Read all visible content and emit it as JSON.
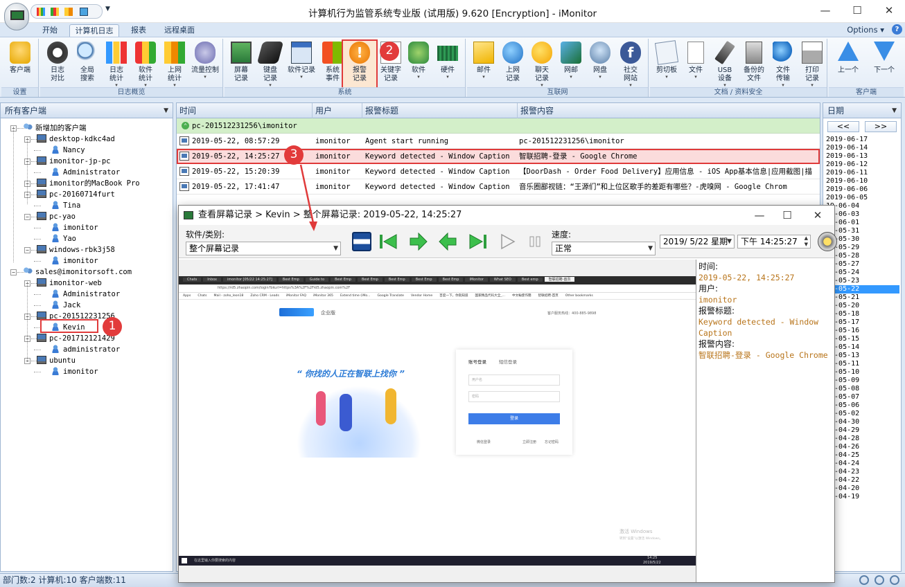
{
  "window": {
    "title": "计算机行为监管系统专业版 (试用版) 9.620 [Encryption] - iMonitor"
  },
  "menu_tabs": [
    "开始",
    "计算机日志",
    "报表",
    "远程桌面"
  ],
  "options_label": "Options",
  "ribbon": {
    "groups": {
      "settings": "设置",
      "log_overview": "日志概览",
      "system": "系统",
      "internet": "互联网",
      "docs_security": "文档 / 资料安全",
      "client": "客户端"
    },
    "buttons": {
      "client": "客户端",
      "daily_compare": "日志对比",
      "global_search": "全局搜索",
      "log_stats": "日志统计",
      "software_stats": "软件统计",
      "web_stats": "上网统计",
      "traffic_control": "流量控制",
      "screen_record": "屏幕记录",
      "keyboard_record": "键盘记录",
      "software_record": "软件记录",
      "system_event": "系统事件",
      "alarm_record": "报警记录",
      "keyword_record": "关键字记录",
      "software": "软件",
      "hardware": "硬件",
      "email": "邮件",
      "web_record": "上网记录",
      "chat_record": "聊天记录",
      "network": "网邮",
      "netdisk": "网盘",
      "social_site": "社交网站",
      "clipboard": "剪切板",
      "file": "文件",
      "usb_device": "USB设备",
      "backup_file": "备份的文件",
      "file_transfer": "文件传输",
      "print_record": "打印记录",
      "prev": "上一个",
      "next": "下一个"
    }
  },
  "left_panel": {
    "header": "所有客户端",
    "tree": [
      {
        "label": "新增加的客户端",
        "kind": "group"
      },
      {
        "label": "desktop-kdkc4ad",
        "kind": "pc"
      },
      {
        "label": "Nancy",
        "kind": "user"
      },
      {
        "label": "imonitor-jp-pc",
        "kind": "pc"
      },
      {
        "label": "Administrator",
        "kind": "user"
      },
      {
        "label": "imonitor的MacBook Pro",
        "kind": "pc"
      },
      {
        "label": "pc-20160714furt",
        "kind": "pc"
      },
      {
        "label": "Tina",
        "kind": "user"
      },
      {
        "label": "pc-yao",
        "kind": "pc"
      },
      {
        "label": "imonitor",
        "kind": "user"
      },
      {
        "label": "Yao",
        "kind": "user"
      },
      {
        "label": "windows-rbk3j58",
        "kind": "pc"
      },
      {
        "label": "imonitor",
        "kind": "user"
      },
      {
        "label": "sales@imonitorsoft.com",
        "kind": "group"
      },
      {
        "label": "imonitor-web",
        "kind": "pc"
      },
      {
        "label": "Administrator",
        "kind": "user"
      },
      {
        "label": "Jack",
        "kind": "user"
      },
      {
        "label": "pc-201512231256",
        "kind": "pc"
      },
      {
        "label": "Kevin",
        "kind": "user"
      },
      {
        "label": "pc-201712121429",
        "kind": "pc"
      },
      {
        "label": "administrator",
        "kind": "user"
      },
      {
        "label": "ubuntu",
        "kind": "pc"
      },
      {
        "label": "imonitor",
        "kind": "user"
      }
    ]
  },
  "table": {
    "columns": [
      "时间",
      "用户",
      "报警标题",
      "报警内容"
    ],
    "group_label": "pc-201512231256\\imonitor",
    "rows": [
      {
        "time": "2019-05-22, 08:57:29",
        "user": "imonitor",
        "title": "Agent start running",
        "content": "pc-201512231256\\imonitor"
      },
      {
        "time": "2019-05-22, 14:25:27",
        "user": "imonitor",
        "title": "Keyword detected - Window Caption",
        "content": "智联招聘-登录 - Google Chrome"
      },
      {
        "time": "2019-05-22, 15:20:39",
        "user": "imonitor",
        "title": "Keyword detected - Window Caption",
        "content": "【DoorDash - Order Food Delivery】应用信息 - iOS App基本信息|应用截图|描"
      },
      {
        "time": "2019-05-22, 17:41:47",
        "user": "imonitor",
        "title": "Keyword detected - Window Caption",
        "content": "音乐圈鄙视链：“王源们”和上位区歌手的差距有哪些？-虎嗅网 - Google Chrom"
      }
    ]
  },
  "right_panel": {
    "header": "日期",
    "prev_btn": "<<",
    "next_btn": ">>",
    "dates": [
      "2019-06-17",
      "2019-06-14",
      "2019-06-13",
      "2019-06-12",
      "2019-06-11",
      "2019-06-10",
      "2019-06-06",
      "2019-06-05",
      "19-06-04",
      "19-06-03",
      "19-06-01",
      "19-05-31",
      "19-05-30",
      "19-05-29",
      "19-05-28",
      "19-05-27",
      "19-05-24",
      "19-05-23",
      "19-05-22",
      "19-05-21",
      "19-05-20",
      "19-05-18",
      "19-05-17",
      "19-05-16",
      "19-05-15",
      "19-05-14",
      "19-05-13",
      "19-05-11",
      "19-05-10",
      "19-05-09",
      "19-05-08",
      "19-05-07",
      "19-05-06",
      "19-05-02",
      "19-04-30",
      "19-04-29",
      "19-04-28",
      "19-04-26",
      "19-04-25",
      "19-04-24",
      "19-04-23",
      "19-04-22",
      "19-04-20",
      "19-04-19"
    ],
    "selected_index": 18
  },
  "status": {
    "text": "部门数:2 计算机:10 客户端数:11"
  },
  "dialog": {
    "title": "查看屏幕记录 > Kevin > 整个屏幕记录: 2019-05-22, 14:25:27",
    "category_label": "软件/类别:",
    "category_value": "整个屏幕记录",
    "speed_label": "速度:",
    "speed_value": "正常",
    "date_value": "2019/ 5/22 星期",
    "time_value": "下午 14:25:27",
    "info": {
      "time_label": "时间:",
      "time_value": "2019-05-22, 14:25:27",
      "user_label": "用户:",
      "user_value": "imonitor",
      "title_label": "报警标题:",
      "title_value": "Keyword detected - Window Caption",
      "content_label": "报警内容:",
      "content_value": "智联招聘-登录 - Google Chrome"
    },
    "snapshot": {
      "tabs": [
        "Chats",
        "Inbox",
        "imonitor [05/22 14:25:27]",
        "Best Emp",
        "Guide to",
        "Best Emp",
        "Best Emp",
        "Best Emp",
        "Best Emp",
        "Best Emp",
        "iMonitor",
        "What SEO",
        "Best emp",
        "智联招聘-首页"
      ],
      "url": "https://rd5.zhaopin.com/login?bkurl=https%3A%2F%2Frd5.zhaopin.com%2F",
      "bookmarks": [
        "Apps",
        "Chats",
        "Mail - zoho_leon18",
        "Zoho CRM - Leads",
        "iMonitor FAQ",
        "iMonitor 365",
        "Extend time (iMo...",
        "Google Translate",
        "Vendor Home",
        "百度一下，你就知道",
        "国家精品代码大全_...",
        "中文輸使作簡",
        "智联招聘-首页",
        "Other bookmarks"
      ],
      "logo_sub": "企业版",
      "hotline": "客户服务热线：400-885-9898",
      "slogan": "“ 你找的人正在智联上找你 ”",
      "login_tab1": "账号登录",
      "login_tab2": "短信登录",
      "username_ph": "用户名",
      "password_ph": "密码",
      "login_btn": "登录",
      "wechat_login": "微信登录",
      "register": "立即注册",
      "forgot": "忘记密码",
      "watermark1": "激活 Windows",
      "watermark2": "转到“设置”以激活 Windows。",
      "taskbar_search": "在这里输入你要搜索的内容",
      "taskbar_time": "14:25",
      "taskbar_date": "2019/5/22"
    }
  },
  "annotations": [
    "1",
    "2",
    "3"
  ],
  "colors": {
    "accent_red": "#e03a3a",
    "info_value": "#b8741a",
    "selected_date": "#3399ff",
    "group_row": "#d3efc9"
  }
}
